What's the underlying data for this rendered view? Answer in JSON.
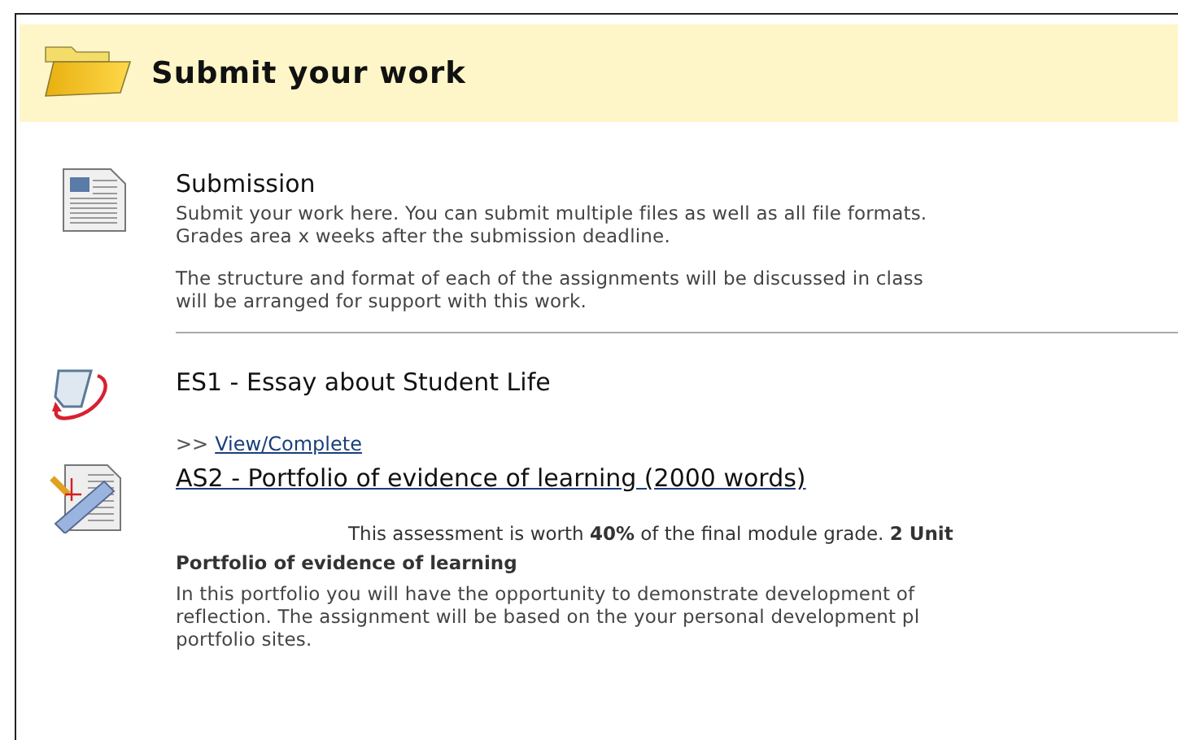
{
  "header": {
    "title": "Submit your work"
  },
  "items": [
    {
      "kind": "section",
      "title": "Submission",
      "paragraphs": [
        [
          "Submit your work here. You can submit multiple files as well as all file formats.",
          "Grades area x weeks after the submission deadline."
        ],
        [
          "The structure and format of each of the assignments will be discussed in class",
          "will be arranged for support with this work."
        ]
      ]
    },
    {
      "kind": "assignment",
      "title": "ES1 - Essay about Student Life",
      "prefix": ">>",
      "link": "View/Complete"
    },
    {
      "kind": "assessment",
      "title": "AS2 - Portfolio of evidence of learning (2000 words)",
      "summary": "This assessment is worth **40%** of the final module grade. **2 Unit**",
      "subtitle": "Portfolio of evidence of learning",
      "paragraphs": [
        [
          "In this portfolio you will have the opportunity to demonstrate development of",
          "reflection. The assignment will be based on the your personal development pl",
          "portfolio sites."
        ]
      ]
    }
  ]
}
